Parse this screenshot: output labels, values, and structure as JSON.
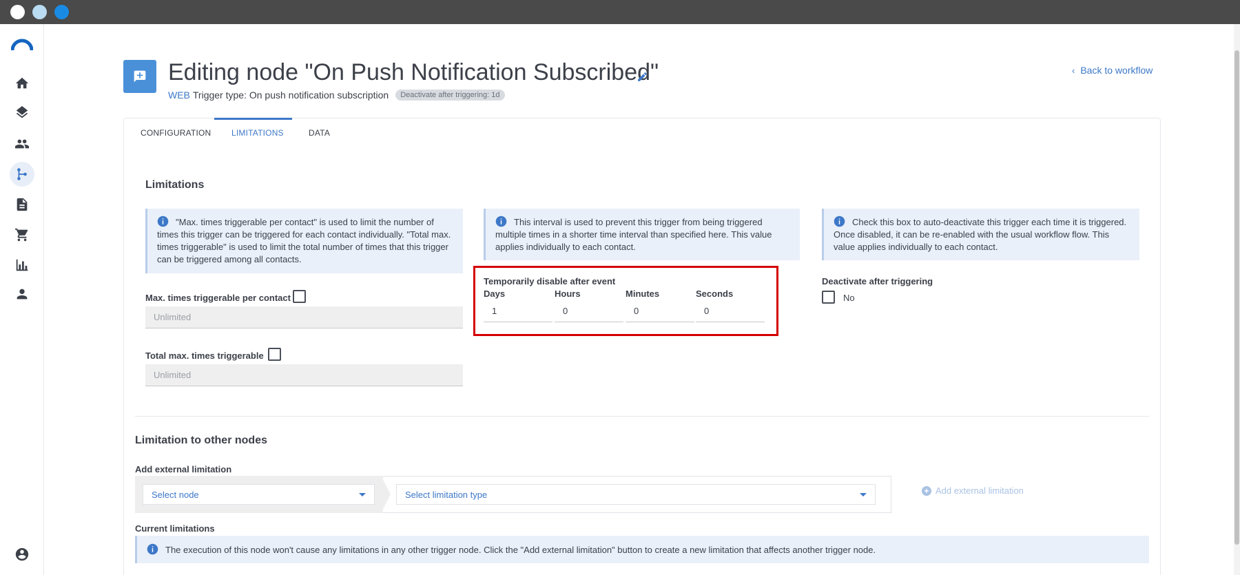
{
  "window": {
    "controls": [
      "close",
      "minimize",
      "maximize"
    ]
  },
  "sidebar": {
    "items": [
      {
        "name": "home",
        "icon": "home-icon"
      },
      {
        "name": "layers",
        "icon": "layers-icon"
      },
      {
        "name": "contacts",
        "icon": "people-icon"
      },
      {
        "name": "workflows",
        "icon": "workflow-icon",
        "active": true
      },
      {
        "name": "documents",
        "icon": "document-icon"
      },
      {
        "name": "shop",
        "icon": "cart-icon"
      },
      {
        "name": "reports",
        "icon": "bar-chart-icon"
      },
      {
        "name": "users",
        "icon": "person-icon"
      }
    ],
    "account_icon": "account-circle-icon"
  },
  "header": {
    "title": "Editing node \"On Push Notification Subscribed\"",
    "channel": "WEB",
    "trigger_type": "Trigger type: On push notification subscription",
    "badge": "Deactivate after triggering: 1d",
    "back_link": "Back to workflow"
  },
  "tabs": [
    {
      "label": "CONFIGURATION",
      "active": false
    },
    {
      "label": "LIMITATIONS",
      "active": true
    },
    {
      "label": "DATA",
      "active": false
    }
  ],
  "limitations": {
    "title": "Limitations",
    "info_max_times": "\"Max. times triggerable per contact\" is used to limit the number of times this trigger can be triggered for each contact individually. \"Total max. times triggerable\" is used to limit the total number of times that this trigger can be triggered among all contacts.",
    "info_interval": "This interval is used to prevent this trigger from being triggered multiple times in a shorter time interval than specified here. This value applies individually to each contact.",
    "info_deactivate": "Check this box to auto-deactivate this trigger each time it is triggered. Once disabled, it can be re-enabled with the usual workflow flow. This value applies individually to each contact.",
    "max_per_contact_label": "Max. times triggerable per contact",
    "max_per_contact_placeholder": "Unlimited",
    "max_per_contact_checked": false,
    "total_max_label": "Total max. times triggerable",
    "total_max_placeholder": "Unlimited",
    "total_max_checked": false,
    "temp_disable_label": "Temporarily disable after event",
    "time_fields": [
      {
        "label": "Days",
        "value": "1"
      },
      {
        "label": "Hours",
        "value": "0"
      },
      {
        "label": "Minutes",
        "value": "0"
      },
      {
        "label": "Seconds",
        "value": "0"
      }
    ],
    "deactivate_label": "Deactivate after triggering",
    "deactivate_checked": false,
    "deactivate_value": "No"
  },
  "other_nodes": {
    "title": "Limitation to other nodes",
    "add_external_label": "Add external limitation",
    "select_node_placeholder": "Select node",
    "select_type_placeholder": "Select limitation type",
    "add_button": "Add external limitation",
    "current_label": "Current limitations",
    "current_info": "The execution of this node won't cause any limitations in any other trigger node. Click the \"Add external limitation\" button to create a new limitation that affects another trigger node."
  },
  "colors": {
    "accent": "#3d78c8",
    "node_icon": "#4a90d9",
    "highlight": "#d40000",
    "info_bg": "#e9f0fa"
  }
}
